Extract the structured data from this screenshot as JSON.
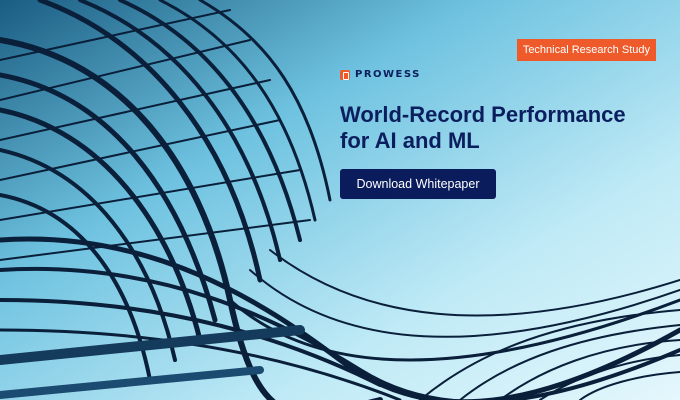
{
  "badge": {
    "label": "Technical Research Study",
    "color": "#ef5a2a"
  },
  "brand": {
    "name": "PROWESS",
    "icon": "prowess-logo-icon",
    "color": "#ef5a2a"
  },
  "headline": {
    "line1": "World-Record Performance",
    "line2": "for AI and ML"
  },
  "cta": {
    "label": "Download Whitepaper",
    "color": "#0b1c5c"
  },
  "colors": {
    "text_primary": "#0b1f5e",
    "background_light": "#dff4fa",
    "structure_dark": "#0a1f3a"
  }
}
